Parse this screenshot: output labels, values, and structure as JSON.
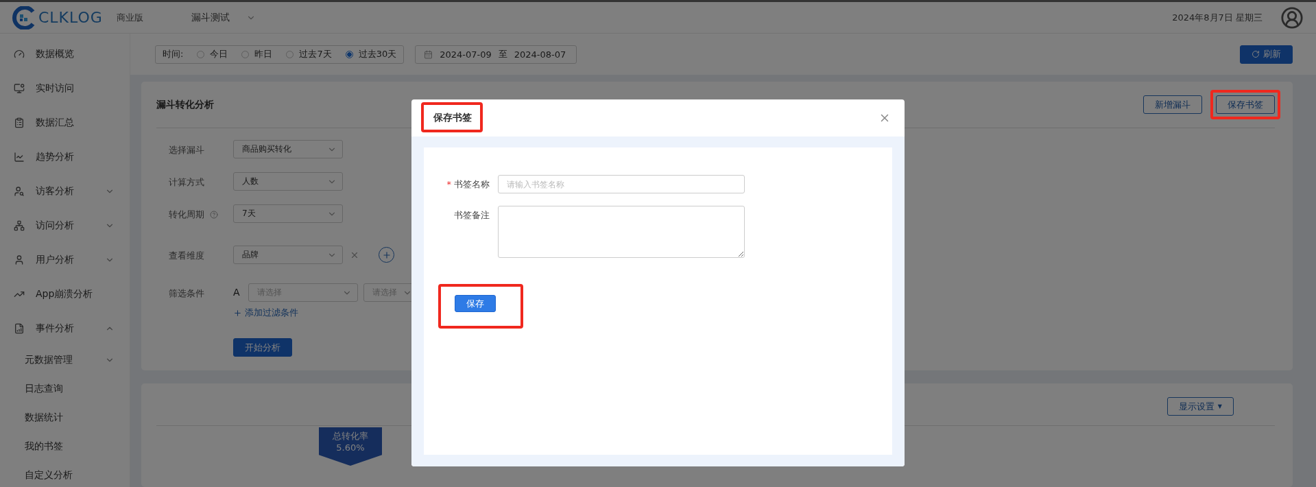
{
  "header": {
    "logo_text": "CLKLOG",
    "edition": "商业版",
    "project": "漏斗测试",
    "date": "2024年8月7日 星期三"
  },
  "sidebar": {
    "items": [
      {
        "label": "数据概览"
      },
      {
        "label": "实时访问"
      },
      {
        "label": "数据汇总"
      },
      {
        "label": "趋势分析"
      },
      {
        "label": "访客分析",
        "expanded": false
      },
      {
        "label": "访问分析",
        "expanded": false
      },
      {
        "label": "用户分析",
        "expanded": false
      },
      {
        "label": "App崩溃分析"
      },
      {
        "label": "事件分析",
        "expanded": true,
        "children": [
          {
            "label": "元数据管理",
            "expanded": false
          },
          {
            "label": "日志查询"
          },
          {
            "label": "数据统计"
          },
          {
            "label": "我的书签"
          },
          {
            "label": "自定义分析"
          }
        ]
      }
    ]
  },
  "toolbar": {
    "time_label": "时间:",
    "time_options": [
      {
        "label": "今日",
        "selected": false
      },
      {
        "label": "昨日",
        "selected": false
      },
      {
        "label": "过去7天",
        "selected": false
      },
      {
        "label": "过去30天",
        "selected": true
      }
    ],
    "date_range": {
      "start": "2024-07-09",
      "separator": "至",
      "end": "2024-08-07"
    },
    "refresh": "刷新"
  },
  "funnel_card": {
    "title": "漏斗转化分析",
    "buttons": [
      {
        "label": "新增漏斗",
        "highlighted": false
      },
      {
        "label": "保存书签",
        "highlighted": true
      }
    ],
    "rows": [
      {
        "kind": "select",
        "label": "选择漏斗",
        "value": "商品购买转化"
      },
      {
        "kind": "select",
        "label": "计算方式",
        "value": "人数"
      },
      {
        "kind": "select",
        "label": "转化周期",
        "value": "7天",
        "help": true
      },
      {
        "kind": "dimension",
        "label": "查看维度",
        "value": "品牌"
      },
      {
        "kind": "filter",
        "label": "筛选条件",
        "prefix": "A",
        "placeholders": [
          "请选择",
          "请选择"
        ],
        "add_link": "添加过滤条件"
      }
    ],
    "submit": "开始分析"
  },
  "result_card": {
    "settings_button": "显示设置",
    "settings_caret": "▼",
    "badge_title": "总转化率",
    "badge_value": "5.60%"
  },
  "modal": {
    "title": "保存书签",
    "title_highlighted": true,
    "required_mark": "*",
    "fields": [
      {
        "kind": "input",
        "label": "书签名称",
        "required": true,
        "placeholder": "请输入书签名称"
      },
      {
        "kind": "textarea",
        "label": "书签备注",
        "required": false
      }
    ],
    "save": "保存",
    "save_highlighted": true
  }
}
